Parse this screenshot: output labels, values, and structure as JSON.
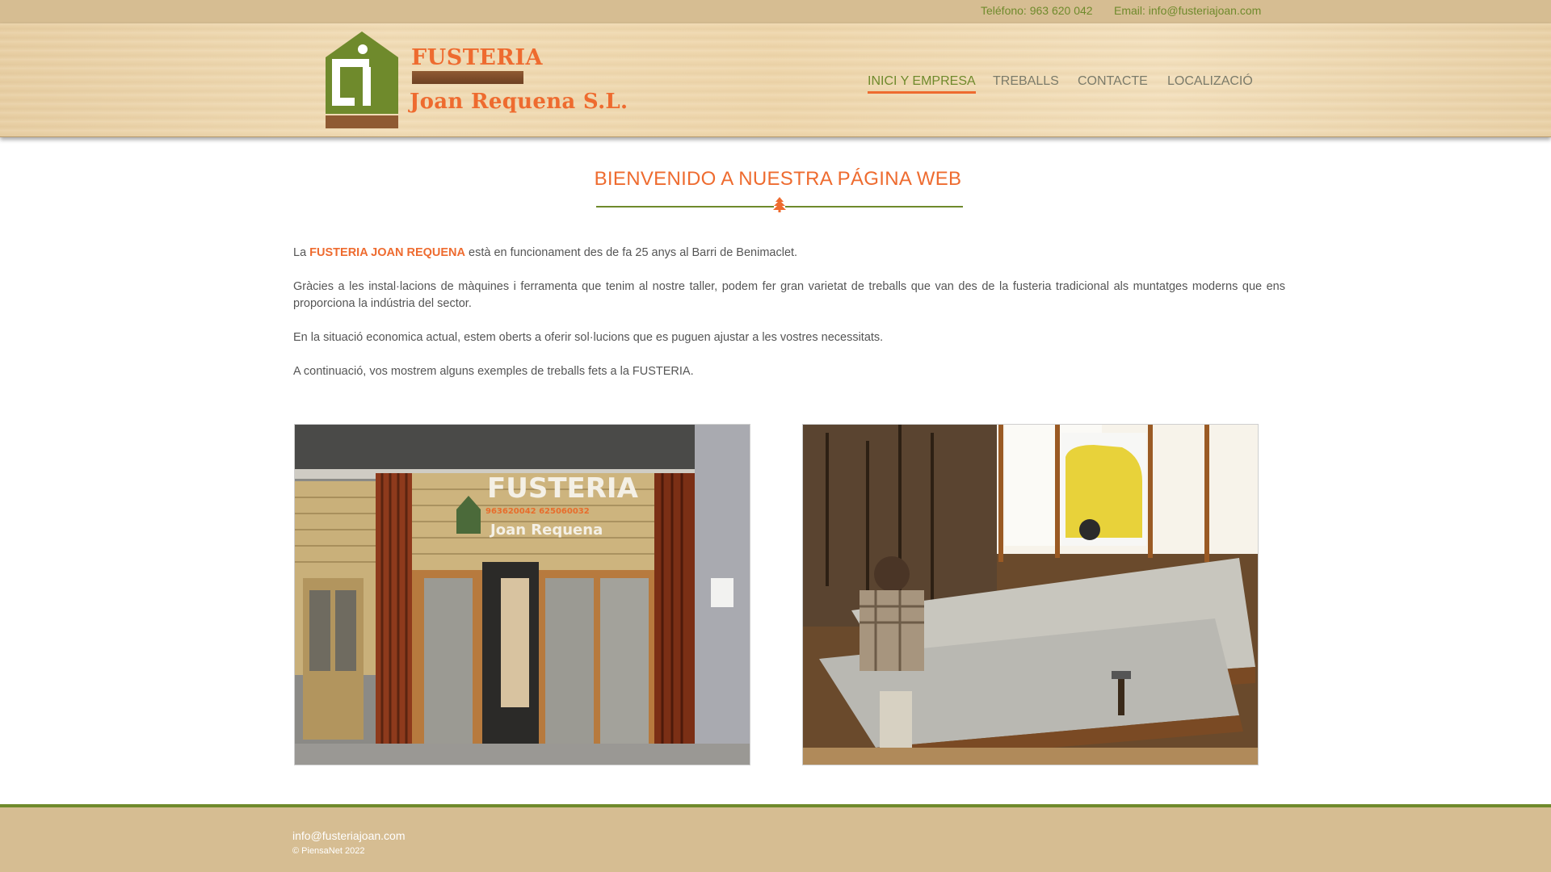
{
  "topbar": {
    "phone": "Teléfono: 963 620 042",
    "email": "Email: info@fusteriajoan.com"
  },
  "logo": {
    "line1": "FUSTERIA",
    "line2": "Joan Requena S.L."
  },
  "nav": {
    "items": [
      {
        "label": "INICI Y EMPRESA",
        "active": true
      },
      {
        "label": "TREBALLS",
        "active": false
      },
      {
        "label": "CONTACTE",
        "active": false
      },
      {
        "label": "LOCALIZACIÓ",
        "active": false
      }
    ]
  },
  "main": {
    "title": "BIENVENIDO A NUESTRA PÁGINA WEB",
    "paragraphs": {
      "p1_pre": "La ",
      "p1_highlight": "FUSTERIA JOAN REQUENA",
      "p1_post": " està en funcionament des de fa 25 anys al Barri de Benimaclet.",
      "p2": "Gràcies a les instal·lacions de màquines i ferramenta que tenim al nostre taller, podem fer gran varietat de treballs que van des de la fusteria tradicional als muntatges moderns que ens proporciona la indústria del sector.",
      "p3": "En la situació economica actual, estem oberts a oferir sol·lucions que es puguen ajustar a les vostres necessitats.",
      "p4": "A continuació, vos mostrem alguns exemples de treballs fets a la FUSTERIA."
    },
    "photos": {
      "left_sign_line1": "FUSTERIA",
      "left_sign_phones": "963620042  625060032",
      "left_sign_line2": "Joan Requena"
    }
  },
  "footer": {
    "email": "info@fusteriajoan.com",
    "copyright": "© PiensaNet 2022"
  },
  "colors": {
    "accent_orange": "#ee6b2f",
    "accent_green": "#6f8a2c",
    "band_tan": "#d6bd92"
  },
  "icons": {
    "divider": "tree-icon"
  }
}
